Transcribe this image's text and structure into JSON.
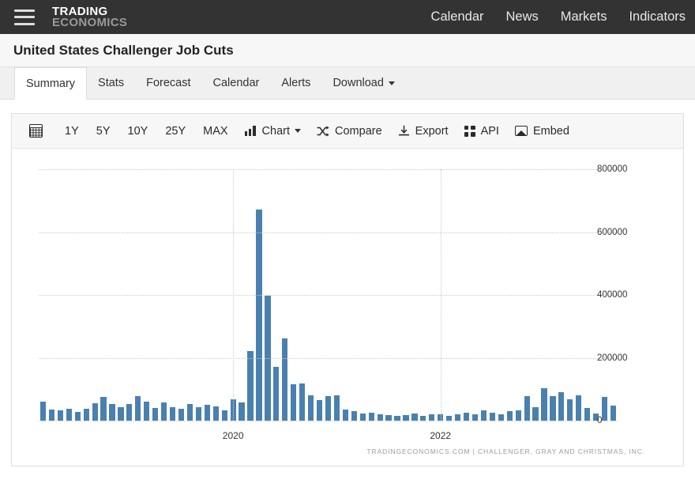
{
  "topbar": {
    "menu_icon": "hamburger-icon",
    "brand_line1": "TRADING",
    "brand_line2": "ECONOMICS",
    "nav": [
      {
        "label": "Calendar"
      },
      {
        "label": "News"
      },
      {
        "label": "Markets"
      },
      {
        "label": "Indicators"
      }
    ]
  },
  "page": {
    "title": "United States Challenger Job Cuts"
  },
  "tabs": [
    {
      "label": "Summary",
      "active": true
    },
    {
      "label": "Stats",
      "active": false
    },
    {
      "label": "Forecast",
      "active": false
    },
    {
      "label": "Calendar",
      "active": false
    },
    {
      "label": "Alerts",
      "active": false
    },
    {
      "label": "Download",
      "active": false,
      "has_caret": true
    }
  ],
  "toolbar": {
    "table_icon": "table-grid-icon",
    "ranges": [
      "1Y",
      "5Y",
      "10Y",
      "25Y",
      "MAX"
    ],
    "chart_label": "Chart",
    "chart_icon": "bar-chart-icon",
    "compare_label": "Compare",
    "compare_icon": "shuffle-icon",
    "export_label": "Export",
    "export_icon": "download-icon",
    "api_label": "API",
    "api_icon": "grid-squares-icon",
    "embed_label": "Embed",
    "embed_icon": "image-icon"
  },
  "colors": {
    "bar": "#4a80b0",
    "topbar_bg": "#333333",
    "grid": "#c9c9c9",
    "credit_text": "#9b9b9b"
  },
  "chart_data": {
    "type": "bar",
    "title": "United States Challenger Job Cuts",
    "xlabel": "",
    "ylabel": "",
    "ylim": [
      0,
      800000
    ],
    "yticks": [
      0,
      200000,
      400000,
      600000,
      800000
    ],
    "ytick_labels": [
      "0",
      "200000",
      "400000",
      "600000",
      "800000"
    ],
    "grid": true,
    "legend": false,
    "source": "TRADINGECONOMICS.COM  |  CHALLENGER, GRAY AND CHRISTMAS, INC.",
    "xtick_labels": [
      "2020",
      "2022"
    ],
    "xtick_index": [
      22,
      46
    ],
    "x": [
      "2018-03",
      "2018-04",
      "2018-05",
      "2018-06",
      "2018-07",
      "2018-08",
      "2018-09",
      "2018-10",
      "2018-11",
      "2018-12",
      "2019-01",
      "2019-02",
      "2019-03",
      "2019-04",
      "2019-05",
      "2019-06",
      "2019-07",
      "2019-08",
      "2019-09",
      "2019-10",
      "2019-11",
      "2019-12",
      "2020-01",
      "2020-02",
      "2020-03",
      "2020-04",
      "2020-05",
      "2020-06",
      "2020-07",
      "2020-08",
      "2020-09",
      "2020-10",
      "2020-11",
      "2020-12",
      "2021-01",
      "2021-02",
      "2021-03",
      "2021-04",
      "2021-05",
      "2021-06",
      "2021-07",
      "2021-08",
      "2021-09",
      "2021-10",
      "2021-11",
      "2021-12",
      "2022-01",
      "2022-02",
      "2022-03",
      "2022-04",
      "2022-05",
      "2022-06",
      "2022-07",
      "2022-08",
      "2022-09",
      "2022-10",
      "2022-11",
      "2022-12",
      "2023-01",
      "2023-02",
      "2023-03",
      "2023-04",
      "2023-05",
      "2023-06",
      "2023-07",
      "2023-08",
      "2023-09"
    ],
    "values": [
      60000,
      36000,
      31500,
      37200,
      27100,
      38500,
      55300,
      75600,
      53000,
      43900,
      53000,
      76800,
      60600,
      40000,
      58600,
      41900,
      38800,
      53500,
      41600,
      50300,
      44600,
      32800,
      67000,
      56700,
      222300,
      671100,
      397000,
      170200,
      262600,
      116000,
      118800,
      80700,
      64800,
      77000,
      79600,
      34500,
      30600,
      22900,
      24600,
      20500,
      18900,
      15700,
      17900,
      22800,
      14900,
      19100,
      19000,
      15200,
      21400,
      24300,
      20700,
      32500,
      25800,
      20500,
      29989,
      33800,
      76800,
      43700,
      102900,
      77700,
      89700,
      66995,
      80100,
      40700,
      23700,
      75100,
      47500
    ]
  }
}
